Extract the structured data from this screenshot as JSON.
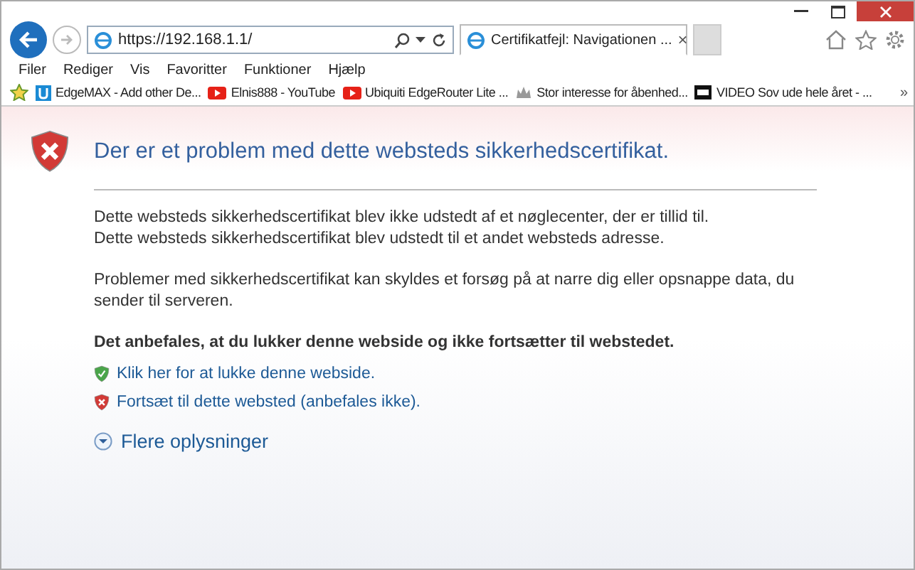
{
  "browser": {
    "address": "https://192.168.1.1/",
    "tabs": [
      {
        "title": "Certifikatfejl: Navigationen ...",
        "close": "×",
        "selected": true
      }
    ],
    "menu": [
      "Filer",
      "Rediger",
      "Vis",
      "Favoritter",
      "Funktioner",
      "Hjælp"
    ],
    "favorites": [
      {
        "kind": "edgemax",
        "label": "EdgeMAX - Add other De..."
      },
      {
        "kind": "youtube",
        "label": "Elnis888 - YouTube"
      },
      {
        "kind": "youtube",
        "label": "Ubiquiti EdgeRouter Lite ..."
      },
      {
        "kind": "crown",
        "label": "Stor interesse for åbenhed..."
      },
      {
        "kind": "dr",
        "label": "VIDEO Sov ude hele året - ..."
      }
    ],
    "more": "»"
  },
  "page": {
    "heading": "Der er et problem med dette websteds sikkerhedscertifikat.",
    "paragraphs": [
      "Dette websteds sikkerhedscertifikat blev ikke udstedt af et nøglecenter, der er tillid til.\nDette websteds sikkerhedscertifikat blev udstedt til et andet websteds adresse.",
      "Problemer med sikkerhedscertifikat kan skyldes et forsøg på at narre dig eller opsnappe data, du sender til serveren."
    ],
    "recommendation": "Det anbefales, at du lukker denne webside og ikke fortsætter til webstedet.",
    "links": [
      {
        "kind": "safe",
        "label": "Klik her for at lukke denne webside."
      },
      {
        "kind": "unsafe",
        "label": "Fortsæt til dette websted (anbefales ikke)."
      }
    ],
    "more_info": {
      "label": "Flere oplysninger",
      "expanded": false
    }
  }
}
